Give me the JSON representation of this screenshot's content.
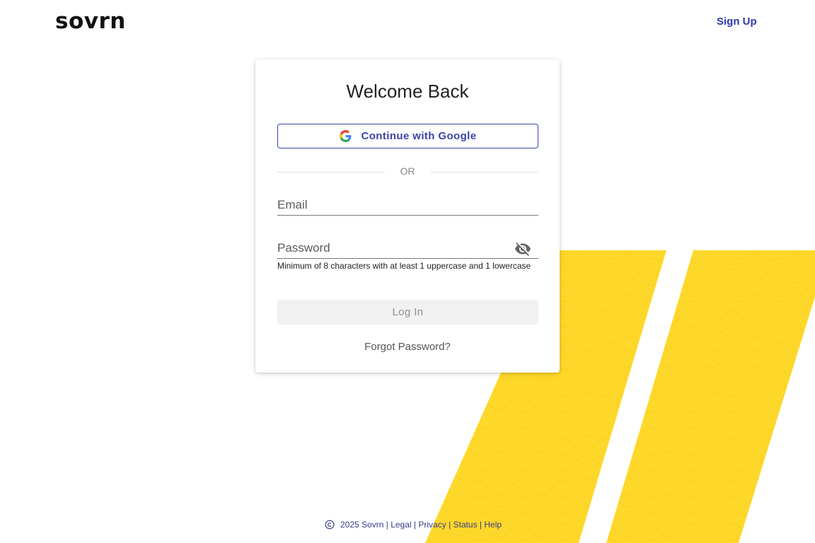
{
  "header": {
    "logo_text": "sovrn",
    "signup_label": "Sign Up"
  },
  "login": {
    "title": "Welcome Back",
    "google_label": "Continue with Google",
    "divider_text": "OR",
    "email_placeholder": "Email",
    "email_value": "",
    "password_placeholder": "Password",
    "password_value": "",
    "password_helper": "Minimum of 8 characters with at least 1 uppercase and 1 lowercase",
    "login_label": "Log In",
    "forgot_label": "Forgot Password?"
  },
  "footer": {
    "year_text": "2025 Sovrn",
    "links": [
      "Legal",
      "Privacy",
      "Status",
      "Help"
    ],
    "separator": "|"
  },
  "colors": {
    "accent": "#3a44a8",
    "stripe_yellow": "#fdd82a",
    "button_disabled_bg": "#f1f1f1"
  },
  "icons": {
    "google": "google-icon",
    "password_toggle": "eye-off-icon",
    "copyright": "copyright-icon"
  }
}
